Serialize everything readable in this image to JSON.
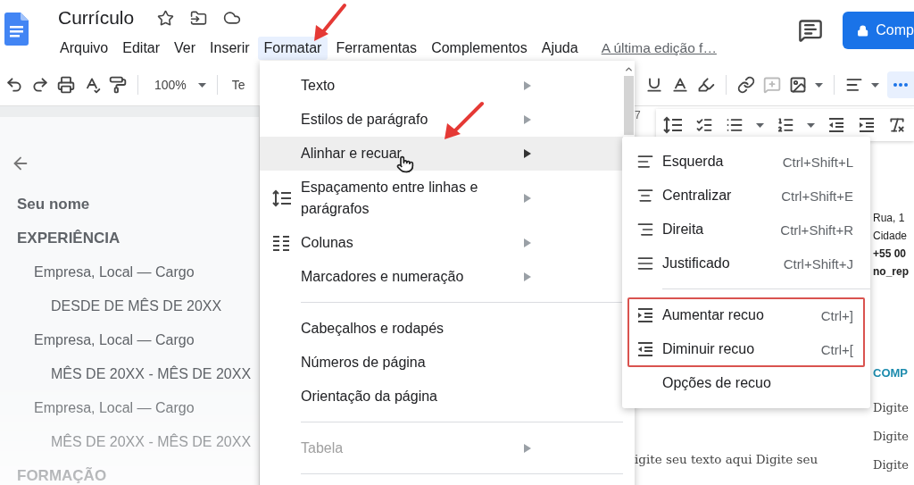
{
  "document": {
    "title": "Currículo"
  },
  "menu_bar": [
    {
      "label": "Arquivo",
      "selected": false
    },
    {
      "label": "Editar",
      "selected": false
    },
    {
      "label": "Ver",
      "selected": false
    },
    {
      "label": "Inserir",
      "selected": false
    },
    {
      "label": "Formatar",
      "selected": true
    },
    {
      "label": "Ferramentas",
      "selected": false
    },
    {
      "label": "Complementos",
      "selected": false
    },
    {
      "label": "Ajuda",
      "selected": false
    }
  ],
  "last_edit_link": "A última edição f…",
  "share_button": {
    "label": "Comp"
  },
  "toolbar": {
    "zoom": "100%",
    "font": "Te",
    "overflow_open": true
  },
  "outline": [
    {
      "text": "Seu nome"
    },
    {
      "text": "EXPERIÊNCIA",
      "children": [
        {
          "text": "Empresa, Local — Cargo",
          "children": [
            {
              "text": "DESDE DE MÊS DE 20XX"
            }
          ]
        },
        {
          "text": "Empresa, Local — Cargo",
          "children": [
            {
              "text": "MÊS DE 20XX - MÊS DE 20XX"
            }
          ]
        },
        {
          "text": "Empresa, Local — Cargo",
          "children": [
            {
              "text": "MÊS DE 20XX - MÊS DE 20XX"
            }
          ]
        }
      ]
    },
    {
      "text": "FORMAÇÃO"
    }
  ],
  "ruler_label": "7",
  "page": {
    "paragraph": "igite seu texto aqui Digite seu",
    "contact": [
      {
        "text": "Rua, 1",
        "bold": false
      },
      {
        "text": "Cidade",
        "bold": false
      },
      {
        "text": "+55 00",
        "bold": true
      },
      {
        "text": "no_rep",
        "bold": true
      }
    ],
    "heading": "COMP",
    "body": [
      "Digite",
      "Digite",
      "Digite"
    ]
  },
  "format_menu": {
    "items": [
      {
        "kind": "item",
        "label": "Texto",
        "submenu": true,
        "highlighted": false,
        "disabled": false
      },
      {
        "kind": "item",
        "label": "Estilos de parágrafo",
        "submenu": true,
        "highlighted": false,
        "disabled": false
      },
      {
        "kind": "item",
        "label": "Alinhar e recuar",
        "submenu": true,
        "highlighted": true,
        "disabled": false
      },
      {
        "kind": "spacing",
        "label": "Espaçamento entre linhas e parágrafos",
        "submenu": true,
        "highlighted": false,
        "disabled": false
      },
      {
        "kind": "columns",
        "label": "Colunas",
        "submenu": true,
        "highlighted": false,
        "disabled": false
      },
      {
        "kind": "item",
        "label": "Marcadores e numeração",
        "submenu": true,
        "highlighted": false,
        "disabled": false
      },
      {
        "kind": "separator"
      },
      {
        "kind": "item",
        "label": "Cabeçalhos e rodapés",
        "submenu": false,
        "highlighted": false,
        "disabled": false
      },
      {
        "kind": "item",
        "label": "Números de página",
        "submenu": false,
        "highlighted": false,
        "disabled": false
      },
      {
        "kind": "item",
        "label": "Orientação da página",
        "submenu": false,
        "highlighted": false,
        "disabled": false
      },
      {
        "kind": "separator"
      },
      {
        "kind": "item",
        "label": "Tabela",
        "submenu": true,
        "highlighted": false,
        "disabled": true
      },
      {
        "kind": "separator"
      }
    ]
  },
  "align_submenu": {
    "items": [
      {
        "kind": "left",
        "label": "Esquerda",
        "shortcut": "Ctrl+Shift+L",
        "boxed": false
      },
      {
        "kind": "center",
        "label": "Centralizar",
        "shortcut": "Ctrl+Shift+E",
        "boxed": false
      },
      {
        "kind": "right",
        "label": "Direita",
        "shortcut": "Ctrl+Shift+R",
        "boxed": false
      },
      {
        "kind": "justify",
        "label": "Justificado",
        "shortcut": "Ctrl+Shift+J",
        "boxed": false
      },
      {
        "kind": "separator"
      },
      {
        "kind": "indent",
        "label": "Aumentar recuo",
        "shortcut": "Ctrl+]",
        "boxed": true
      },
      {
        "kind": "outdent",
        "label": "Diminuir recuo",
        "shortcut": "Ctrl+[",
        "boxed": true
      },
      {
        "kind": "plain",
        "label": "Opções de recuo",
        "boxed": false
      }
    ]
  }
}
